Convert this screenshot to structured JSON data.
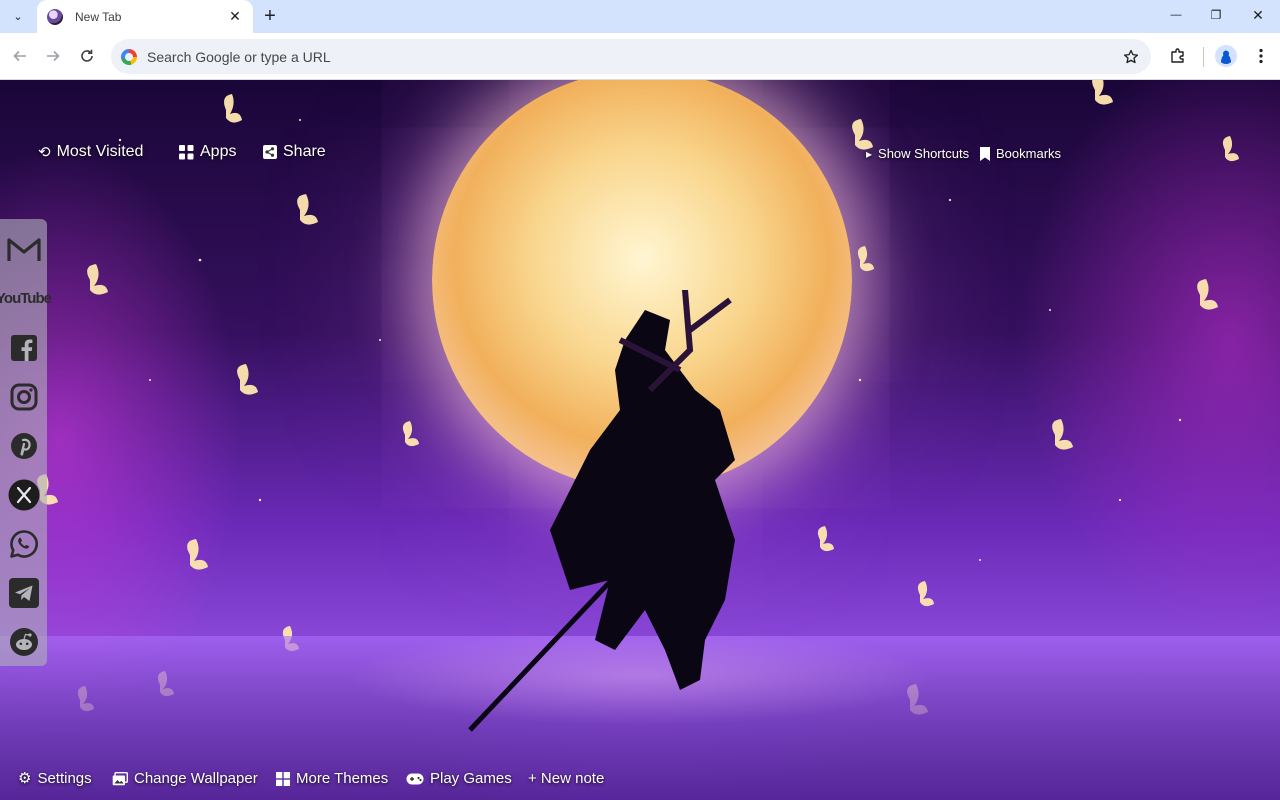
{
  "browser": {
    "tab": {
      "title": "New Tab",
      "close_symbol": "✕"
    },
    "new_tab_symbol": "+",
    "tab_search_symbol": "⌄",
    "window": {
      "minimize": "—",
      "restore": "❐",
      "close": "✕"
    },
    "omnibox": {
      "placeholder": "Search Google or type a URL",
      "value": ""
    },
    "icons": [
      "back-arrow-icon",
      "forward-arrow-icon",
      "reload-icon",
      "google-icon",
      "star-icon",
      "extensions-icon",
      "profile-icon",
      "kebab-menu-icon"
    ]
  },
  "newtab": {
    "top_links": {
      "most_visited": "Most Visited",
      "apps": "Apps",
      "share": "Share",
      "show_shortcuts": "Show Shortcuts",
      "bookmarks": "Bookmarks"
    },
    "bottom_links": {
      "settings": "Settings",
      "change_wallpaper": "Change Wallpaper",
      "more_themes": "More Themes",
      "play_games": "Play Games",
      "new_note": "+ New note"
    },
    "social": [
      "gmail",
      "youtube",
      "facebook",
      "instagram",
      "pinterest",
      "x",
      "whatsapp",
      "telegram",
      "reddit"
    ],
    "youtube_label": "YouTube"
  },
  "colors": {
    "tabstrip": "#d3e3fd",
    "toolbar": "#ffffff",
    "omnibox": "#eef1f7",
    "social_bar": "#afafb9",
    "moon": "#f9d68e",
    "wallpaper_purple": "#6b2ab8"
  }
}
